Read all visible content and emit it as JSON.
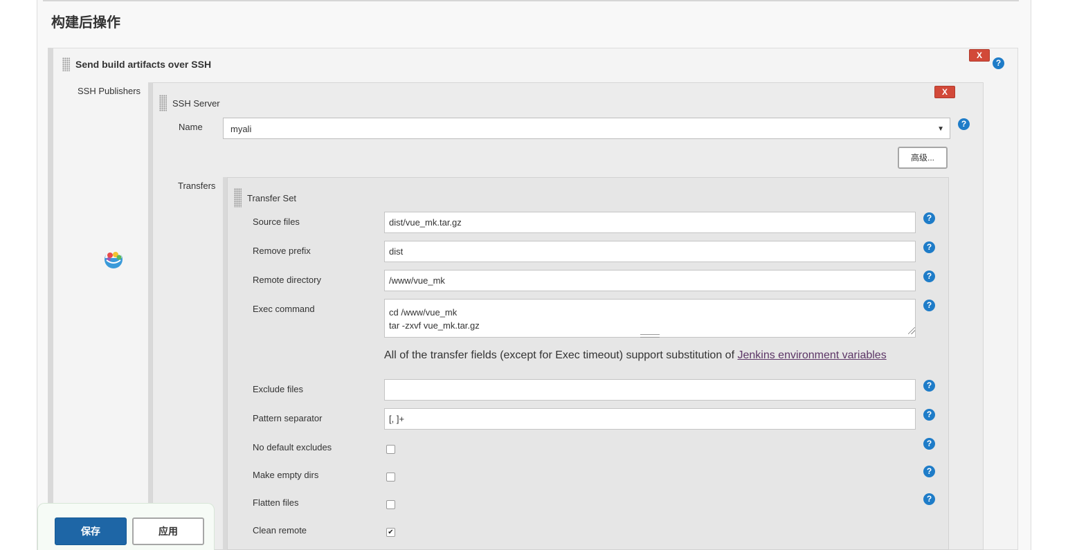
{
  "section": {
    "title": "构建后操作"
  },
  "step": {
    "title": "Send build artifacts over SSH",
    "delete_label": "X",
    "help": "?"
  },
  "publishers": {
    "label": "SSH Publishers"
  },
  "server": {
    "title": "SSH Server",
    "delete_label": "X",
    "name_label": "Name",
    "name_value": "myali",
    "name_help": "?",
    "advanced_label": "高级..."
  },
  "transfers": {
    "label": "Transfers"
  },
  "transfer_set": {
    "title": "Transfer Set",
    "fields": [
      {
        "label": "Source files",
        "value": "dist/vue_mk.tar.gz",
        "help": "?"
      },
      {
        "label": "Remove prefix",
        "value": "dist",
        "help": "?"
      },
      {
        "label": "Remote directory",
        "value": "/www/vue_mk",
        "help": "?"
      },
      {
        "label": "Exec command",
        "value": "cd /www/vue_mk\ntar -zxvf vue_mk.tar.gz",
        "help": "?"
      },
      {
        "label": "Exclude files",
        "value": "",
        "help": "?"
      },
      {
        "label": "Pattern separator",
        "value": "[, ]+",
        "help": "?"
      }
    ],
    "note_prefix": "All of the transfer fields (except for Exec timeout) support substitution of ",
    "note_link": "Jenkins environment variables",
    "checkboxes": [
      {
        "label": "No default excludes",
        "checked": false,
        "help": "?"
      },
      {
        "label": "Make empty dirs",
        "checked": false,
        "help": "?"
      },
      {
        "label": "Flatten files",
        "checked": false,
        "help": "?"
      },
      {
        "label": "Clean remote",
        "checked": true
      }
    ]
  },
  "buttons": {
    "save": "保存",
    "apply": "应用"
  },
  "colors": {
    "primary": "#1e66a6",
    "delete": "#d24939",
    "help": "#1e7cc8",
    "link": "#5c3566"
  }
}
